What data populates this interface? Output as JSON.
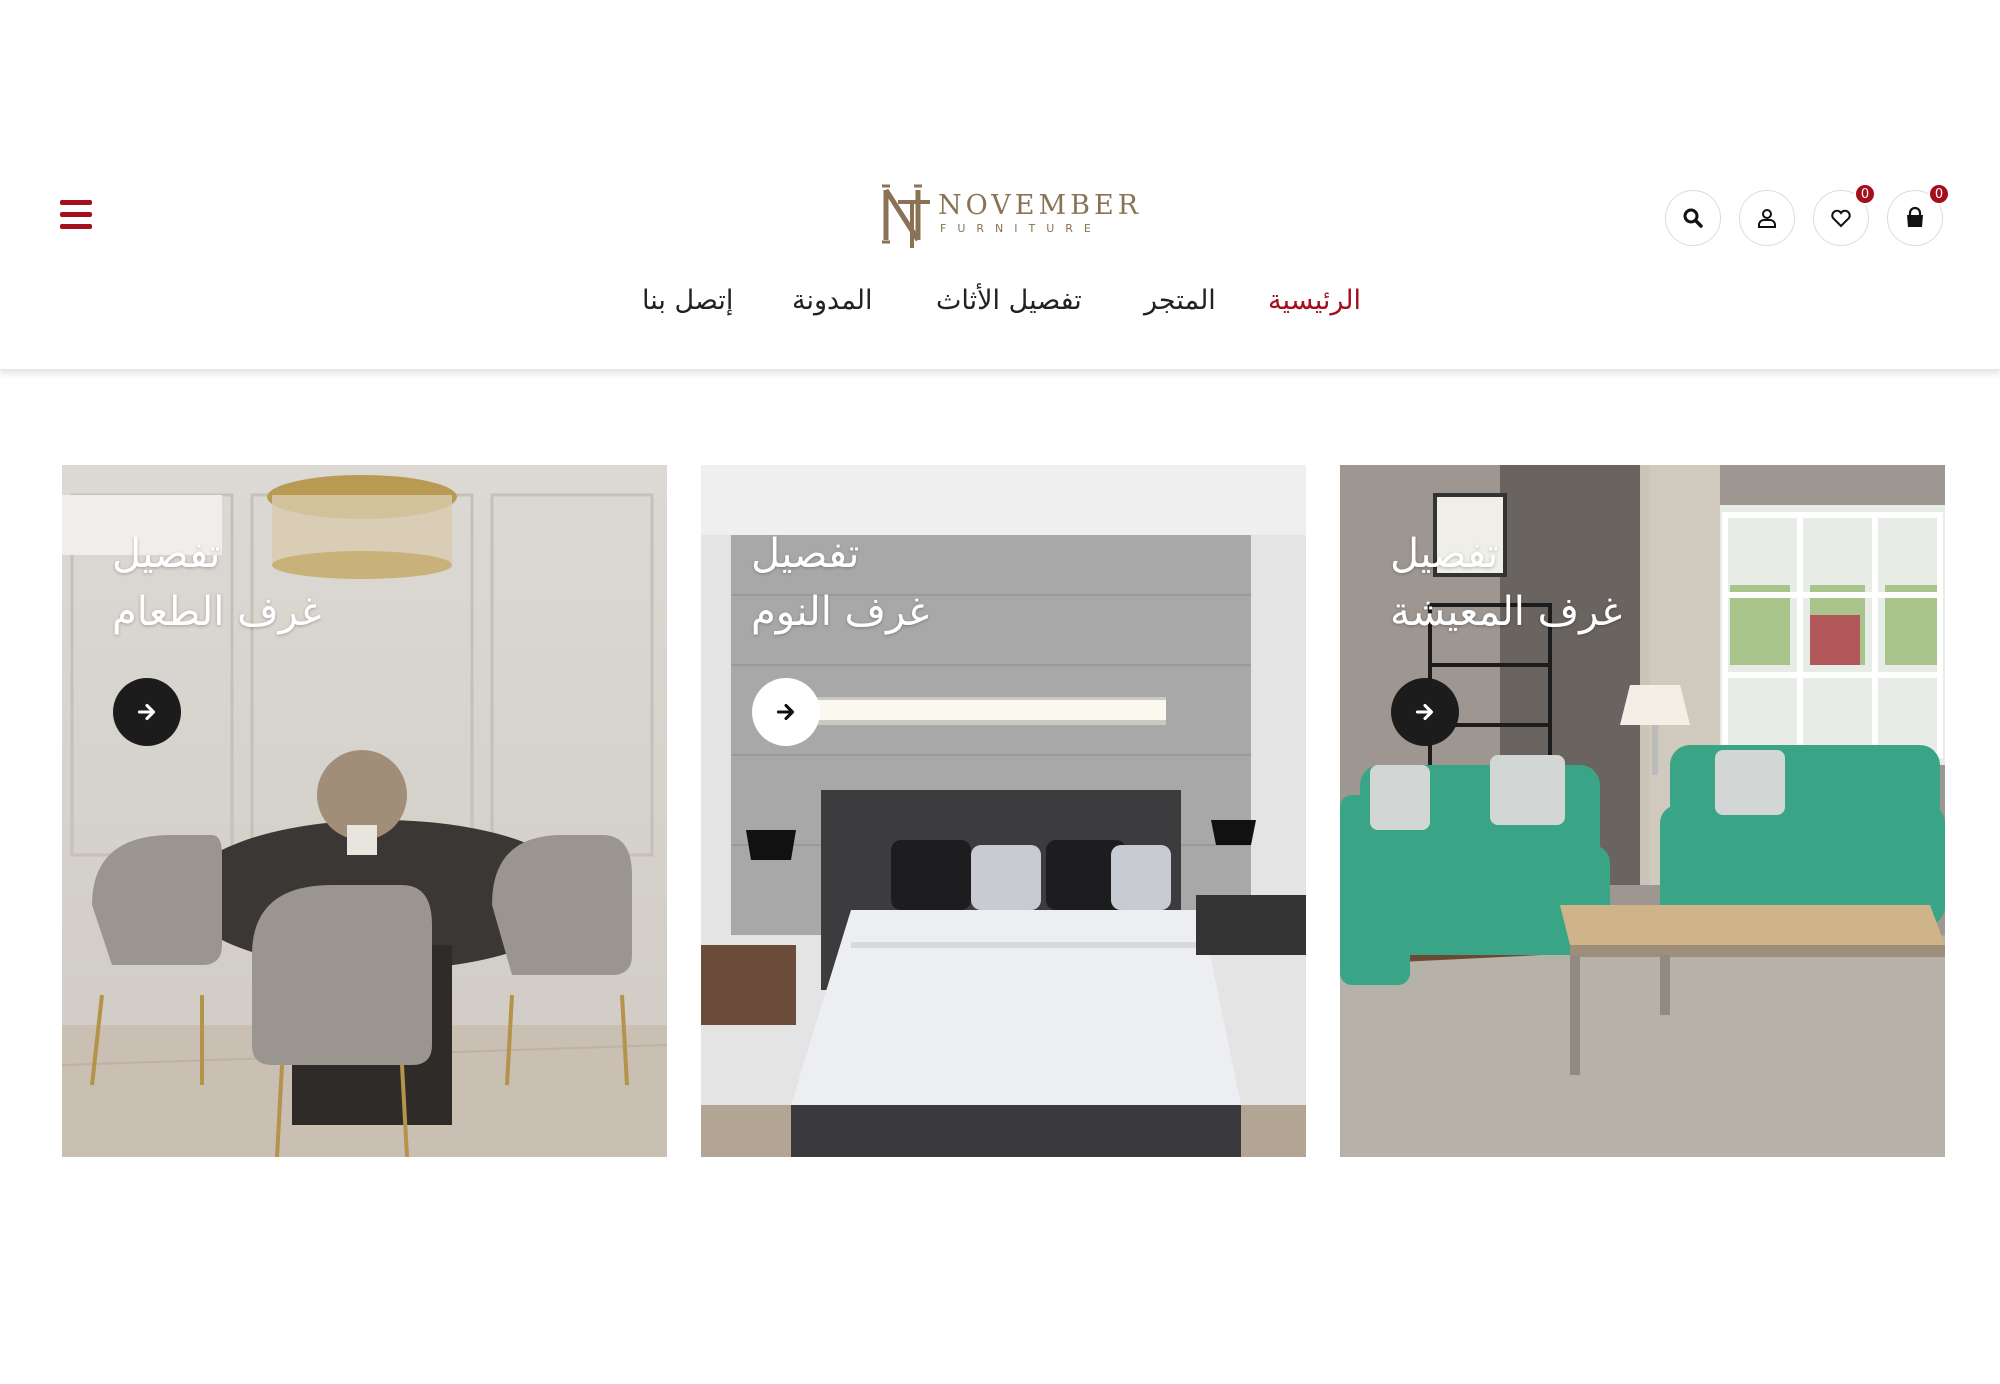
{
  "brand": {
    "name": "NOVEMBER",
    "tagline": "FURNITURE",
    "monogram": "NF",
    "color": "#8a7355"
  },
  "colors": {
    "accent": "#a50f1b",
    "text": "#222222"
  },
  "header": {
    "menu_icon": "hamburger-icon",
    "cart_count": "0",
    "wishlist_count": "0",
    "icons": [
      "cart-icon",
      "heart-icon",
      "user-icon",
      "search-icon"
    ]
  },
  "nav": {
    "items": [
      {
        "label": "الرئيسية",
        "active": true
      },
      {
        "label": "المتجر",
        "active": false
      },
      {
        "label": "تفصيل الأثاث",
        "active": false
      },
      {
        "label": "المدونة",
        "active": false
      },
      {
        "label": "إتصل بنا",
        "active": false
      }
    ]
  },
  "cards": [
    {
      "line1": "تفصيل",
      "line2": "غرف الطعام",
      "button_style": "dark",
      "icon": "arrow-right-icon"
    },
    {
      "line1": "تفصيل",
      "line2": "غرف النوم",
      "button_style": "light",
      "icon": "arrow-right-icon"
    },
    {
      "line1": "تفصيل",
      "line2": "غرف المعيشة",
      "button_style": "dark",
      "icon": "arrow-right-icon"
    }
  ]
}
